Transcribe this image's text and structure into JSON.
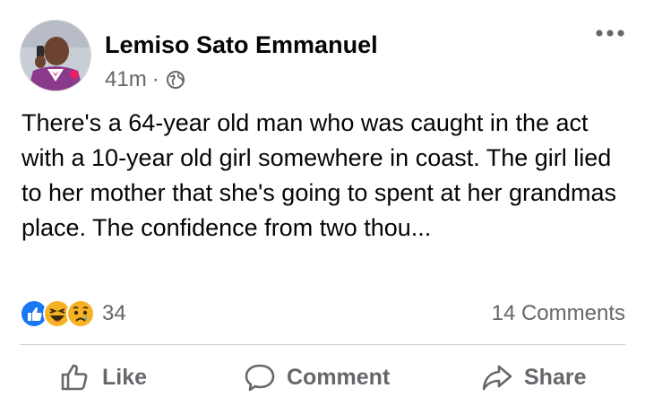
{
  "post": {
    "author": "Lemiso Sato Emmanuel",
    "time": "41m",
    "separator": "·",
    "privacy_icon": "globe-icon",
    "more_icon": "more-horizontal-icon",
    "text": "There's a 64-year old man who was caught in the act with a 10-year old girl somewhere in coast. The girl lied to her mother that she's going to spent at her grandmas place. The confidence from two thou..."
  },
  "reactions": {
    "icons": [
      "like-reaction-icon",
      "haha-reaction-icon",
      "sad-reaction-icon"
    ],
    "count": "34",
    "comments": "14 Comments"
  },
  "actions": {
    "like": "Like",
    "comment": "Comment",
    "share": "Share"
  },
  "colors": {
    "text": "#050505",
    "secondary": "#65676b",
    "like_blue": "#1877f2",
    "divider": "#ced0d4"
  }
}
